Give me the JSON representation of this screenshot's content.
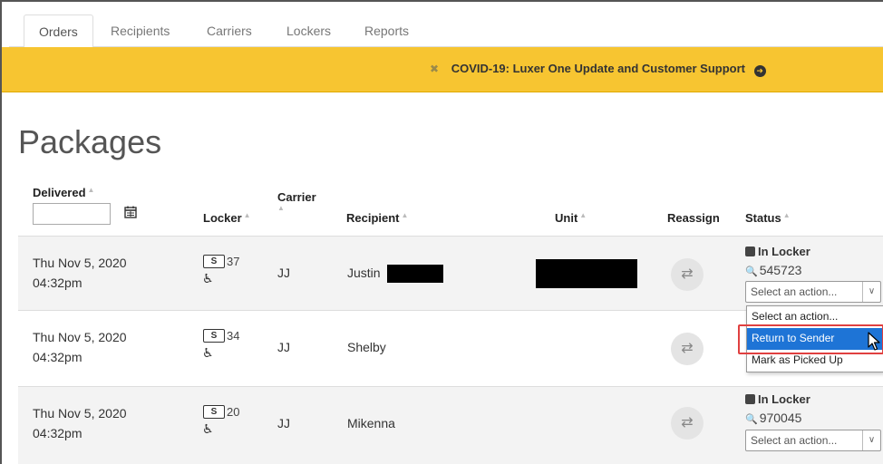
{
  "tabs": [
    "Orders",
    "Recipients",
    "Carriers",
    "Lockers",
    "Reports"
  ],
  "banner": {
    "close_glyph": "✖",
    "text": "COVID-19: Luxer One Update and Customer Support",
    "arrow_glyph": "➜",
    "color": "#f7c531"
  },
  "page": {
    "title": "Packages"
  },
  "columns": {
    "delivered": "Delivered",
    "locker": "Locker",
    "carrier": "Carrier",
    "recipient": "Recipient",
    "unit": "Unit",
    "reassign": "Reassign",
    "status": "Status"
  },
  "icons": {
    "sort": "sort-caret-icon",
    "calendar": "calendar-icon",
    "wheelchair": "wheelchair-icon",
    "reassign": "swap-arrows-icon",
    "key": "key-icon",
    "status": "status-square-icon",
    "cursor": "mouse-pointer-icon"
  },
  "rows": [
    {
      "date": "Thu Nov 5, 2020",
      "time": "04:32pm",
      "locker_size": "S",
      "locker_num": "37",
      "carrier": "JJ",
      "recipient": "Justin",
      "status": "In Locker",
      "code": "545723",
      "select": "Select an action...",
      "reassign_glyph": "⇄",
      "wheel_glyph": "♿"
    },
    {
      "date": "Thu Nov 5, 2020",
      "time": "04:32pm",
      "locker_size": "S",
      "locker_num": "34",
      "carrier": "JJ",
      "recipient": "Shelby",
      "reassign_glyph": "⇄",
      "wheel_glyph": "♿"
    },
    {
      "date": "Thu Nov 5, 2020",
      "time": "04:32pm",
      "locker_size": "S",
      "locker_num": "20",
      "carrier": "JJ",
      "recipient": "Mikenna",
      "status": "In Locker",
      "code": "970045",
      "select": "Select an action...",
      "reassign_glyph": "⇄",
      "wheel_glyph": "♿"
    }
  ],
  "dropdown": {
    "options": [
      "Select an action...",
      "Return to Sender",
      "Mark as Picked Up"
    ],
    "highlighted": "Return to Sender",
    "highlight_color": "#1e74d6",
    "callout_color": "#e04040"
  },
  "glyphs": {
    "sort": "▲",
    "chevron": "∨",
    "key": "🔍"
  }
}
